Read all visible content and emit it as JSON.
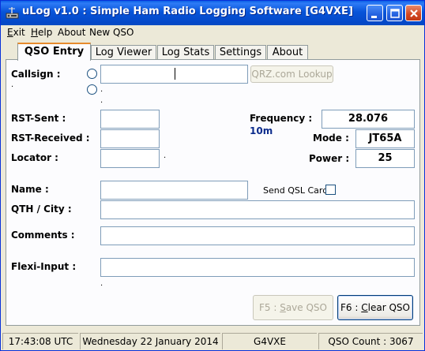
{
  "window": {
    "title": "uLog v1.0 : Simple Ham Radio Logging Software    [G4VXE]"
  },
  "menu": {
    "exit": "Exit",
    "help": "Help",
    "about": "About",
    "new_qso": "New QSO"
  },
  "tabs": [
    {
      "label": "QSO Entry"
    },
    {
      "label": "Log Viewer"
    },
    {
      "label": "Log Stats"
    },
    {
      "label": "Settings"
    },
    {
      "label": "About"
    }
  ],
  "form": {
    "callsign_label": "Callsign :",
    "callsign_value": "",
    "qrz_button": "QRZ.com Lookup",
    "rst_sent_label": "RST-Sent :",
    "rst_sent_value": "",
    "rst_received_label": "RST-Received :",
    "rst_received_value": "",
    "locator_label": "Locator  :",
    "locator_value": "",
    "frequency_label": "Frequency :",
    "frequency_value": "28.076",
    "band_value": "10m",
    "mode_label": "Mode :",
    "mode_value": "JT65A",
    "power_label": "Power :",
    "power_value": "25",
    "name_label": "Name :",
    "name_value": "",
    "send_qsl_label": "Send QSL Card",
    "qth_label": "QTH / City :",
    "qth_value": "",
    "comments_label": "Comments  :",
    "comments_value": "",
    "flexi_label": "Flexi-Input :",
    "flexi_value": "",
    "save_button_prefix": "F5 : ",
    "save_button_key": "S",
    "save_button_rest": "ave QSO",
    "clear_button_prefix": "F6 : ",
    "clear_button_key": "C",
    "clear_button_rest": "lear QSO"
  },
  "status": {
    "time": "17:43:08  UTC",
    "date": "Wednesday 22 January 2014",
    "callsign": "G4VXE",
    "qso_count": "QSO Count : 3067"
  },
  "colors": {
    "title_bar": "#0754d9",
    "band_text": "#0b2b8c",
    "active_tab_accent": "#e68b2c"
  }
}
